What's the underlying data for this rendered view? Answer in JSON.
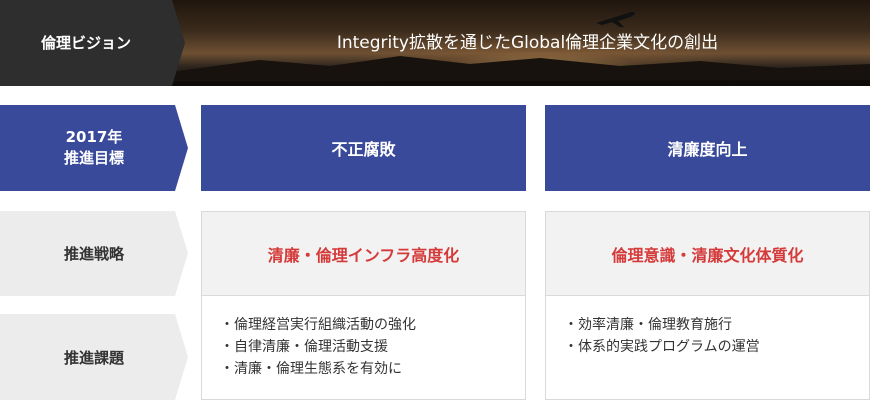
{
  "vision": {
    "label": "倫理ビジョン",
    "text": "Integrity拡散を通じたGlobal倫理企業文化の創出"
  },
  "goal_row": {
    "label_line1": "2017年",
    "label_line2": "推進目標",
    "items": [
      "不正腐敗",
      "清廉度向上"
    ]
  },
  "strategy_row": {
    "label": "推進戦略",
    "items": [
      "清廉・倫理インフラ高度化",
      "倫理意識・清廉文化体質化"
    ]
  },
  "task_row": {
    "label": "推進課題",
    "columns": [
      [
        "倫理経営実行組織活動の強化",
        "自律清廉・倫理活動支援",
        "清廉・倫理生態系を有効に"
      ],
      [
        "効率清廉・倫理教育施行",
        "体系的実践プログラムの運営"
      ]
    ]
  },
  "colors": {
    "goal_blue": "#3a4a9a",
    "strategy_red": "#d53a3a",
    "label_gray": "#ececec",
    "vision_dark": "#2e2e2e"
  },
  "icons": [
    "airplane-icon"
  ]
}
